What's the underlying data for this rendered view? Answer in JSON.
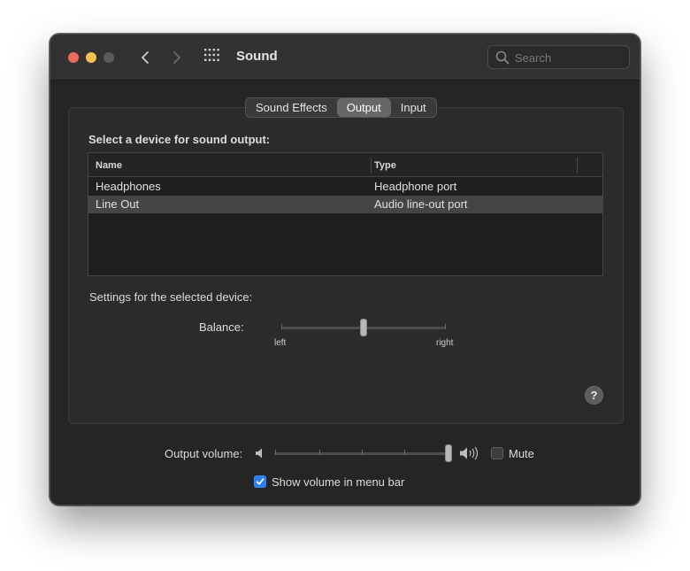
{
  "window": {
    "title": "Sound",
    "search_placeholder": "Search"
  },
  "tabs": [
    {
      "label": "Sound Effects",
      "selected": false
    },
    {
      "label": "Output",
      "selected": true
    },
    {
      "label": "Input",
      "selected": false
    }
  ],
  "output": {
    "heading": "Select a device for sound output:",
    "columns": [
      "Name",
      "Type"
    ],
    "devices": [
      {
        "name": "Headphones",
        "type": "Headphone port",
        "selected": false
      },
      {
        "name": "Line Out",
        "type": "Audio line-out port",
        "selected": true
      }
    ],
    "settings_label": "Settings for the selected device:",
    "balance": {
      "label": "Balance:",
      "left_label": "left",
      "right_label": "right",
      "value": 0.5
    }
  },
  "volume": {
    "label": "Output volume:",
    "value": 1.0,
    "mute_label": "Mute",
    "mute_checked": false,
    "show_in_menu_bar_label": "Show volume in menu bar",
    "show_in_menu_bar_checked": true
  },
  "colors": {
    "accent": "#2a7ff5",
    "close": "#ed6a5e",
    "minimize": "#f5bf4f"
  }
}
